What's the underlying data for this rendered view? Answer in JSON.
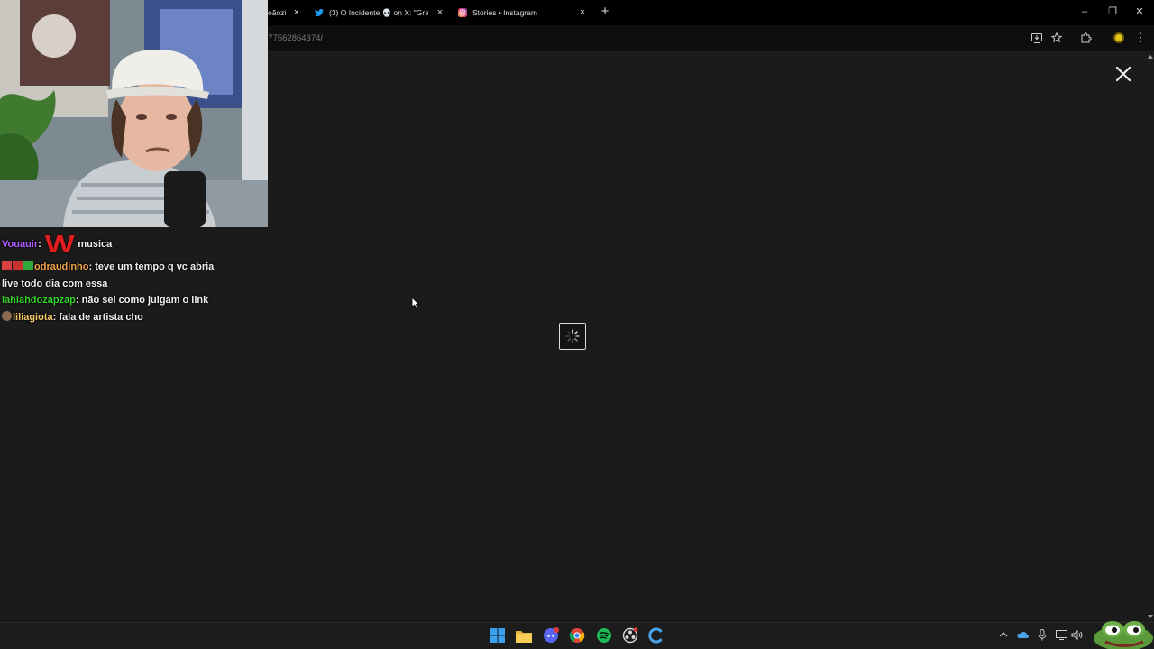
{
  "browser": {
    "tabs": [
      {
        "title": "oãozi",
        "icon": "generic-tab-icon"
      },
      {
        "title": "(3) O Incidente 💀 on X: \"Graç",
        "icon": "twitter-bird-icon"
      },
      {
        "title": "Stories • Instagram",
        "icon": "instagram-icon"
      }
    ],
    "new_tab_symbol": "+",
    "close_symbol": "×",
    "window_controls": {
      "minimize": "–",
      "restore": "❐",
      "close": "✕"
    },
    "url_fragment": "977562864374/"
  },
  "chat": {
    "messages": [
      {
        "user": "Vouauir",
        "user_color": "#b05cff",
        "emote": "W",
        "text": "musica"
      },
      {
        "user": "odraudinho",
        "user_color": "#f4a64a",
        "text": "teve um tempo q vc abria live todo dia com essa"
      },
      {
        "user": "lahlahdozapzap",
        "user_color": "#37d42c",
        "text": "não sei como julgam o link"
      },
      {
        "user": "liliagiota",
        "user_color": "#f2c86a",
        "text": "fala de artista cho"
      }
    ],
    "separator": ":"
  },
  "colors": {
    "page_bg": "#1b1b1b",
    "tabbar_bg": "#000000",
    "taskbar_bg": "#1c1c1c"
  },
  "taskbar": {
    "apps": [
      "windows-start-icon",
      "file-explorer-icon",
      "discord-icon",
      "chrome-icon",
      "spotify-icon",
      "obs-icon",
      "edge-ccleaner-icon"
    ],
    "tray": [
      "chevron-up-icon",
      "onedrive-icon",
      "microphone-icon",
      "network-icon",
      "volume-icon"
    ]
  }
}
